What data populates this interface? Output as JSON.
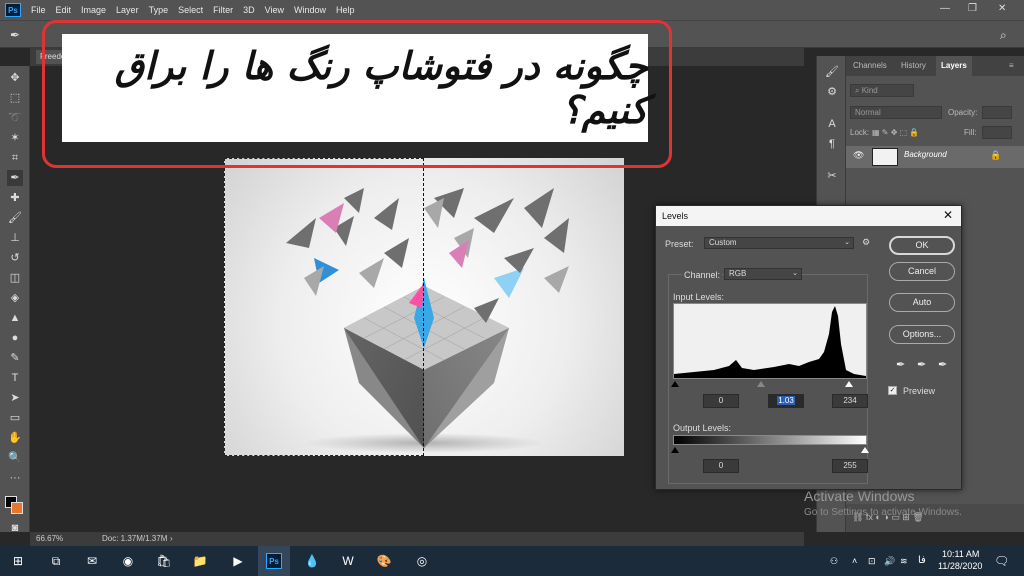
{
  "menubar": {
    "items": [
      "File",
      "Edit",
      "Image",
      "Layer",
      "Type",
      "Select",
      "Filter",
      "3D",
      "View",
      "Window",
      "Help"
    ]
  },
  "document": {
    "tab_label": "Freedo",
    "zoom": "66.67%",
    "doc_size": "Doc: 1.37M/1.37M"
  },
  "title_overlay": {
    "text": "چگونه در فتوشاپ رنگ ها را براق کنیم؟"
  },
  "layers_panel": {
    "tabs": [
      "Channels",
      "History",
      "Layers"
    ],
    "kind_filter": "Kind",
    "blend_mode": "Normal",
    "opacity_label": "Opacity:",
    "lock_label": "Lock:",
    "fill_label": "Fill:",
    "layer_name": "Background"
  },
  "levels_dialog": {
    "title": "Levels",
    "preset_label": "Preset:",
    "preset_value": "Custom",
    "channel_label": "Channel:",
    "channel_value": "RGB",
    "input_levels_label": "Input Levels:",
    "input_black": "0",
    "input_gamma": "1.03",
    "input_white": "234",
    "output_levels_label": "Output Levels:",
    "output_black": "0",
    "output_white": "255",
    "buttons": {
      "ok": "OK",
      "cancel": "Cancel",
      "auto": "Auto",
      "options": "Options..."
    },
    "preview_label": "Preview",
    "preview_checked": true
  },
  "watermark": {
    "line1": "Activate Windows",
    "line2": "Go to Settings to activate Windows."
  },
  "taskbar": {
    "time": "10:11 AM",
    "date": "11/28/2020",
    "lang": "فا"
  },
  "colors": {
    "foreground": "#000000",
    "background": "#e8772e",
    "title_border": "#e03434",
    "selection_highlight": "#2e5fb4"
  }
}
